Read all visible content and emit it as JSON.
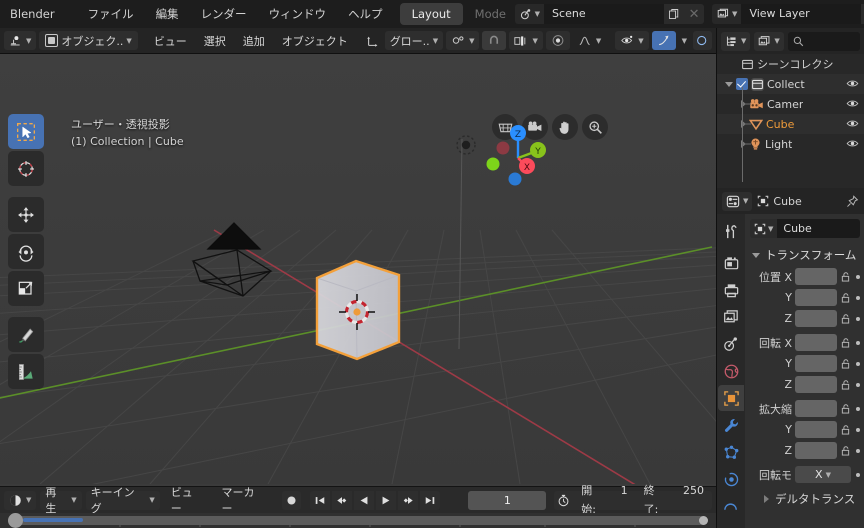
{
  "topbar": {
    "app_name": "Blender",
    "menus": [
      "ファイル",
      "編集",
      "レンダー",
      "ウィンドウ",
      "ヘルプ"
    ],
    "workspace_tabs": [
      {
        "label": "Layout",
        "active": true
      },
      {
        "label": "Modeling",
        "active": false
      }
    ],
    "scene": {
      "icon": "scene-icon",
      "value": "Scene",
      "new_icon": "duplicate-icon",
      "unlink_icon": "close-icon"
    },
    "view_layer": {
      "icon": "viewlayer-icon",
      "value": "View Layer",
      "new_icon": "duplicate-icon",
      "unlink_icon": "close-icon"
    }
  },
  "viewport_header": {
    "editor_type": "editor-type-icon",
    "mode": "オブジェク..",
    "menus": [
      "ビュー",
      "選択",
      "追加",
      "オブジェクト"
    ],
    "transform_orientation": "グロー..",
    "snap_icon": "magnet-icon",
    "proportional_icon": "proportional-icon",
    "visibility_icon": "eye-icon",
    "shading_icon": "shading-icon"
  },
  "viewport": {
    "overlay_line1": "ユーザー・透視投影",
    "overlay_line2": "(1) Collection | Cube",
    "tools": [
      {
        "name": "tweak-tool",
        "active": true
      },
      {
        "name": "cursor-tool",
        "active": false
      },
      {
        "name": "move-tool",
        "active": false
      },
      {
        "name": "rotate-tool",
        "active": false
      },
      {
        "name": "scale-tool",
        "active": false
      },
      {
        "name": "annotate-tool",
        "active": false
      },
      {
        "name": "measure-tool",
        "active": false
      }
    ],
    "nav_buttons": [
      "zoom-region-icon",
      "camera-view-icon",
      "pan-view-icon",
      "zoom-view-icon"
    ],
    "gizmo_axes": [
      {
        "label": "X",
        "color": "#fc4b5b"
      },
      {
        "label": "Y",
        "color": "#88c21b"
      },
      {
        "label": "Z",
        "color": "#2a8fff"
      }
    ],
    "objects": [
      "Camera",
      "Cube",
      "Light"
    ]
  },
  "timeline": {
    "editor_icon": "timeline-icon",
    "menus": [
      {
        "label": "再生",
        "dropdown": true
      },
      {
        "label": "キーイング",
        "dropdown": true
      },
      {
        "label": "ビュー",
        "dropdown": false
      },
      {
        "label": "マーカー",
        "dropdown": false
      }
    ],
    "record_icon": "record-icon",
    "playback": [
      "jump-start-icon",
      "prev-keyframe-icon",
      "play-reverse-icon",
      "play-icon",
      "next-keyframe-icon",
      "jump-end-icon"
    ],
    "current_frame": "1",
    "use_preview_icon": "stopwatch-icon",
    "start_label": "開始:",
    "start_value": "1",
    "end_label": "終了:",
    "end_value": "250"
  },
  "outliner": {
    "display_mode_icon": "outliner-icon",
    "filter_icon": "filter-icon",
    "search_icon": "search-icon",
    "search_placeholder": "",
    "rows": [
      {
        "label": "シーンコレクシ",
        "icon": "collection-icon",
        "indent": 16,
        "type": "scene-collection",
        "selected": false,
        "alt": false,
        "expander": false,
        "checkbox": false,
        "eye": false
      },
      {
        "label": "Collect",
        "icon": "collection-icon",
        "indent": 8,
        "type": "collection",
        "selected": false,
        "alt": true,
        "expander": "down",
        "checkbox": true,
        "eye": true
      },
      {
        "label": "Camer",
        "icon": "camera-icon",
        "indent": 24,
        "type": "object",
        "selected": false,
        "alt": false,
        "expander": "right",
        "checkbox": false,
        "eye": true
      },
      {
        "label": "Cube",
        "icon": "mesh-icon",
        "indent": 24,
        "type": "object",
        "selected": true,
        "alt": true,
        "expander": "right",
        "checkbox": false,
        "eye": true
      },
      {
        "label": "Light",
        "icon": "light-icon",
        "indent": 24,
        "type": "object",
        "selected": false,
        "alt": false,
        "expander": "right",
        "checkbox": false,
        "eye": true
      }
    ]
  },
  "properties": {
    "editor_icon": "properties-icon",
    "breadcrumb_icon": "object-icon",
    "breadcrumb": "Cube",
    "pin_icon": "pin-icon",
    "id_icon": "object-icon",
    "id_value": "Cube",
    "tabs": [
      {
        "name": "tool-tab",
        "active": false
      },
      {
        "name": "render-tab",
        "active": false
      },
      {
        "name": "output-tab",
        "active": false
      },
      {
        "name": "view-layer-tab",
        "active": false
      },
      {
        "name": "scene-tab",
        "active": false
      },
      {
        "name": "world-tab",
        "active": false
      },
      {
        "name": "object-tab",
        "active": true
      },
      {
        "name": "modifier-tab",
        "active": false
      },
      {
        "name": "particles-tab",
        "active": false
      },
      {
        "name": "physics-tab",
        "active": false
      },
      {
        "name": "constraint-tab",
        "active": false
      }
    ],
    "transform_section": "トランスフォーム",
    "rows": [
      {
        "label": "位置 X",
        "value": "",
        "lock": true,
        "anim": true
      },
      {
        "label": "Y",
        "value": "",
        "lock": true,
        "anim": true
      },
      {
        "label": "Z",
        "value": "",
        "lock": true,
        "anim": true
      },
      {
        "label": "回転 X",
        "value": "",
        "lock": true,
        "anim": true
      },
      {
        "label": "Y",
        "value": "",
        "lock": true,
        "anim": true
      },
      {
        "label": "Z",
        "value": "",
        "lock": true,
        "anim": true
      },
      {
        "label": "拡大縮",
        "value": "",
        "lock": true,
        "anim": true
      },
      {
        "label": "Y",
        "value": "",
        "lock": true,
        "anim": true
      },
      {
        "label": "Z",
        "value": "",
        "lock": true,
        "anim": true
      }
    ],
    "rotation_mode_label": "回転モ",
    "rotation_mode_value": "X",
    "delta_transform": "デルタトランス"
  },
  "colors": {
    "accent_blue": "#4772b3",
    "accent_orange": "#ee9b3a",
    "axis_x": "#fc4b5b",
    "axis_y": "#88c21b",
    "axis_z": "#2a8fff",
    "viewport_bg": "#3b3b3b"
  }
}
